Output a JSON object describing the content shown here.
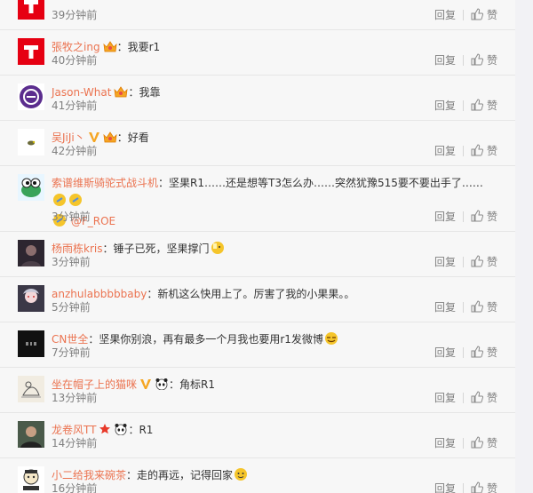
{
  "actions": {
    "reply_label": "回复",
    "like_label": "赞"
  },
  "comments": [
    {
      "user": "",
      "badges": [],
      "text": "",
      "time": "39分钟前",
      "avatar": "red-T-logo-avatar"
    },
    {
      "user": "張牧之ing",
      "badges": [
        "vip-crown-badge"
      ],
      "text": "：我要r1",
      "time": "40分钟前",
      "avatar": "red-T-logo-avatar"
    },
    {
      "user": "Jason-What",
      "badges": [
        "vip-crown-badge"
      ],
      "text": "：我靠",
      "time": "41分钟前",
      "avatar": "purple-circle-avatar"
    },
    {
      "user": "吴JiJi丶",
      "badges": [
        "verified-v-badge",
        "vip-crown-badge"
      ],
      "text": "：好看",
      "time": "42分钟前",
      "avatar": "small-bird-avatar"
    },
    {
      "user": "索谱维斯骑驼式战斗机",
      "badges": [],
      "text": "：坚果R1……还是想等T3怎么办……突然犹豫515要不要出手了……",
      "mention": "@F_ROE",
      "time": "3分钟前",
      "avatar": "cartoon-frog-avatar"
    },
    {
      "user": "杨雨栋kris",
      "badges": [],
      "text": "：锤子已死，坚果撑门",
      "time": "3分钟前",
      "avatar": "dark-photo-avatar"
    },
    {
      "user": "anzhulabbbbbaby",
      "badges": [],
      "text": "：新机这么快用上了。厉害了我的小果果。。",
      "time": "5分钟前",
      "avatar": "anime-girl-avatar"
    },
    {
      "user": "CN世全",
      "badges": [],
      "text": "：坚果你别浪，再有最多一个月我也要用r1发微博",
      "time": "7分钟前",
      "avatar": "black-logo-avatar"
    },
    {
      "user": "坐在帽子上的猫咪",
      "badges": [
        "verified-v-badge",
        "panda-badge"
      ],
      "text": "：角标R1",
      "time": "13分钟前",
      "avatar": "cat-sketch-avatar"
    },
    {
      "user": "龙卷风TT",
      "badges": [
        "star-badge",
        "panda-badge"
      ],
      "text": "：R1",
      "time": "14分钟前",
      "avatar": "man-photo-avatar"
    },
    {
      "user": "小二给我来碗茶",
      "badges": [],
      "text": "：走的再远，记得回家",
      "time": "16分钟前",
      "avatar": "cartoon-character-avatar"
    }
  ]
}
